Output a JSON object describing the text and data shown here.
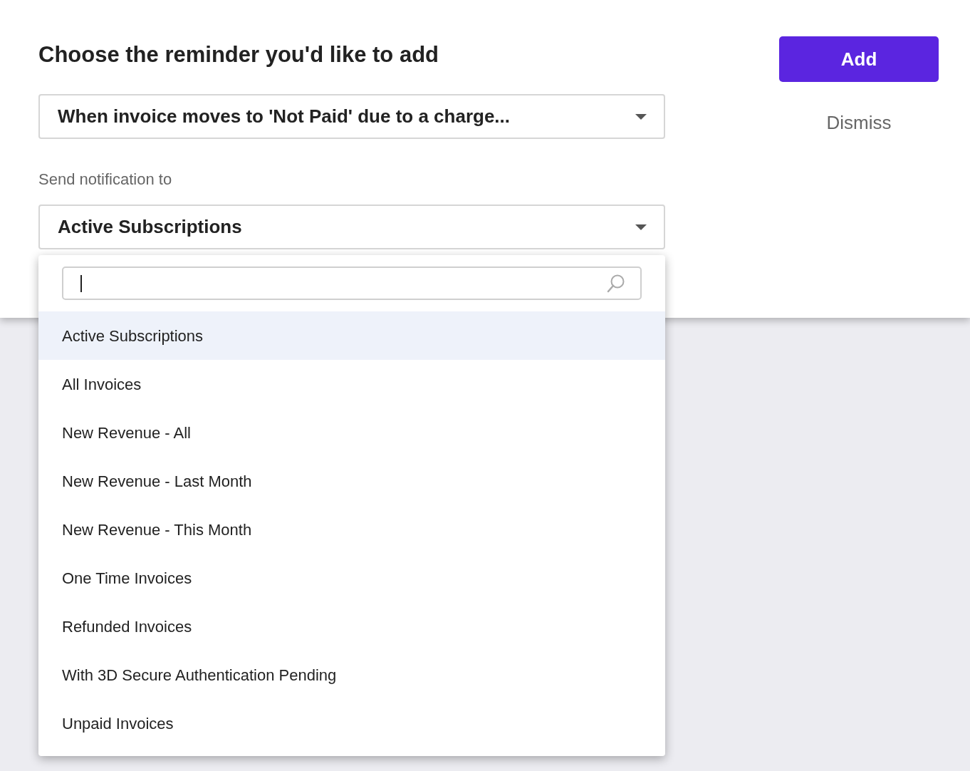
{
  "title": "Choose the reminder you'd like to add",
  "reminder_select": {
    "value": "When invoice moves to 'Not Paid' due to a charge..."
  },
  "notification_label": "Send notification to",
  "notification_select": {
    "value": "Active Subscriptions"
  },
  "dropdown": {
    "options": [
      {
        "label": "Active Subscriptions",
        "selected": true
      },
      {
        "label": "All Invoices",
        "selected": false
      },
      {
        "label": "New Revenue - All",
        "selected": false
      },
      {
        "label": "New Revenue - Last Month",
        "selected": false
      },
      {
        "label": "New Revenue - This Month",
        "selected": false
      },
      {
        "label": "One Time Invoices",
        "selected": false
      },
      {
        "label": "Refunded Invoices",
        "selected": false
      },
      {
        "label": "With 3D Secure Authentication Pending",
        "selected": false
      },
      {
        "label": "Unpaid Invoices",
        "selected": false
      }
    ]
  },
  "buttons": {
    "add": "Add",
    "dismiss": "Dismiss"
  }
}
